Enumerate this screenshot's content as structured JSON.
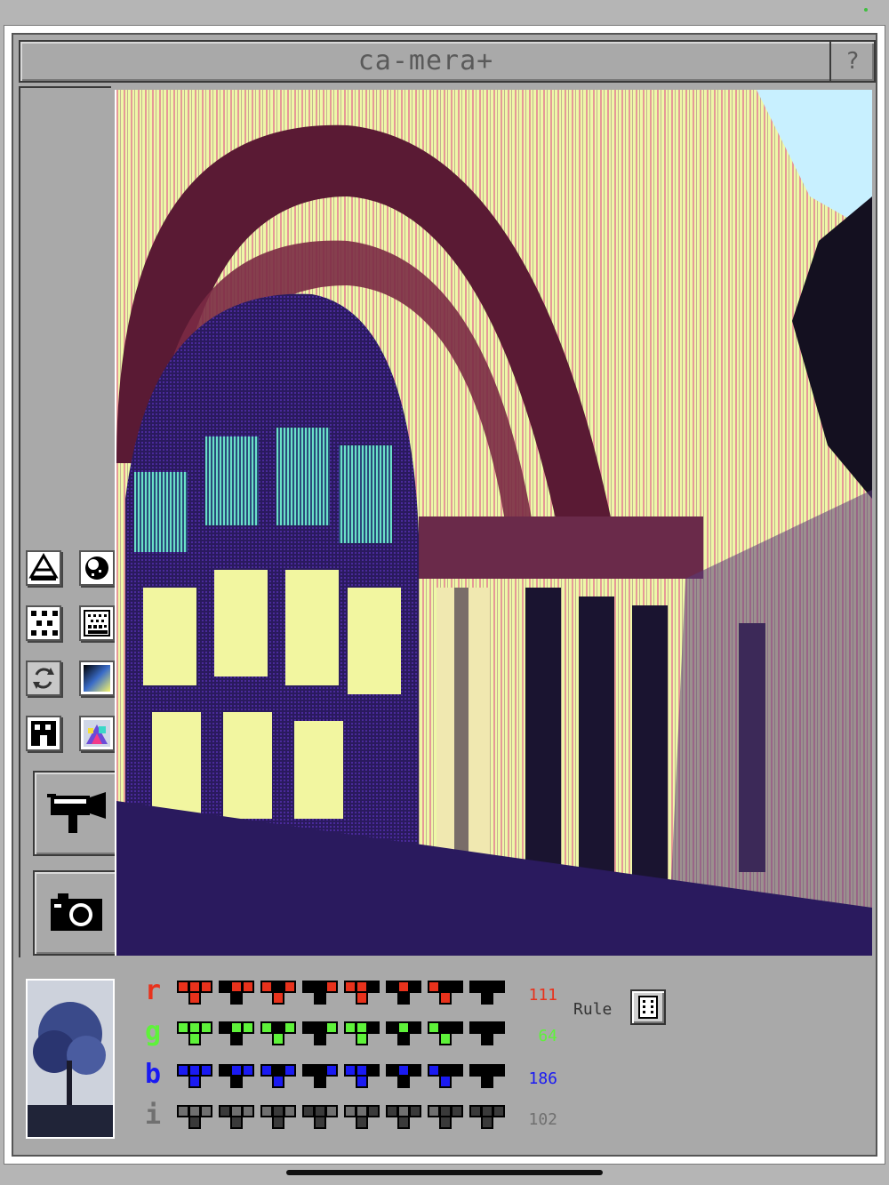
{
  "app": {
    "title": "ca-mera+",
    "help_label": "?"
  },
  "sidebar": {
    "tools": [
      {
        "name": "exposure-icon"
      },
      {
        "name": "dither-icon"
      },
      {
        "name": "grid-pattern-icon"
      },
      {
        "name": "halftone-icon"
      },
      {
        "name": "flip-camera-icon"
      },
      {
        "name": "gradient-icon"
      },
      {
        "name": "pixel-shape-icon"
      },
      {
        "name": "color-palette-icon"
      }
    ],
    "video_button": {
      "icon": "video-camera-icon"
    },
    "photo_button": {
      "icon": "camera-icon"
    }
  },
  "channels": [
    {
      "label": "r",
      "value": "111",
      "color": "#e8321c"
    },
    {
      "label": "g",
      "value": "64",
      "color": "#5ef23a"
    },
    {
      "label": "b",
      "value": "186",
      "color": "#1a1af2"
    },
    {
      "label": "i",
      "value": "102",
      "color": "#707070"
    }
  ],
  "rule": {
    "label": "Rule",
    "icon": "dice-icon"
  }
}
